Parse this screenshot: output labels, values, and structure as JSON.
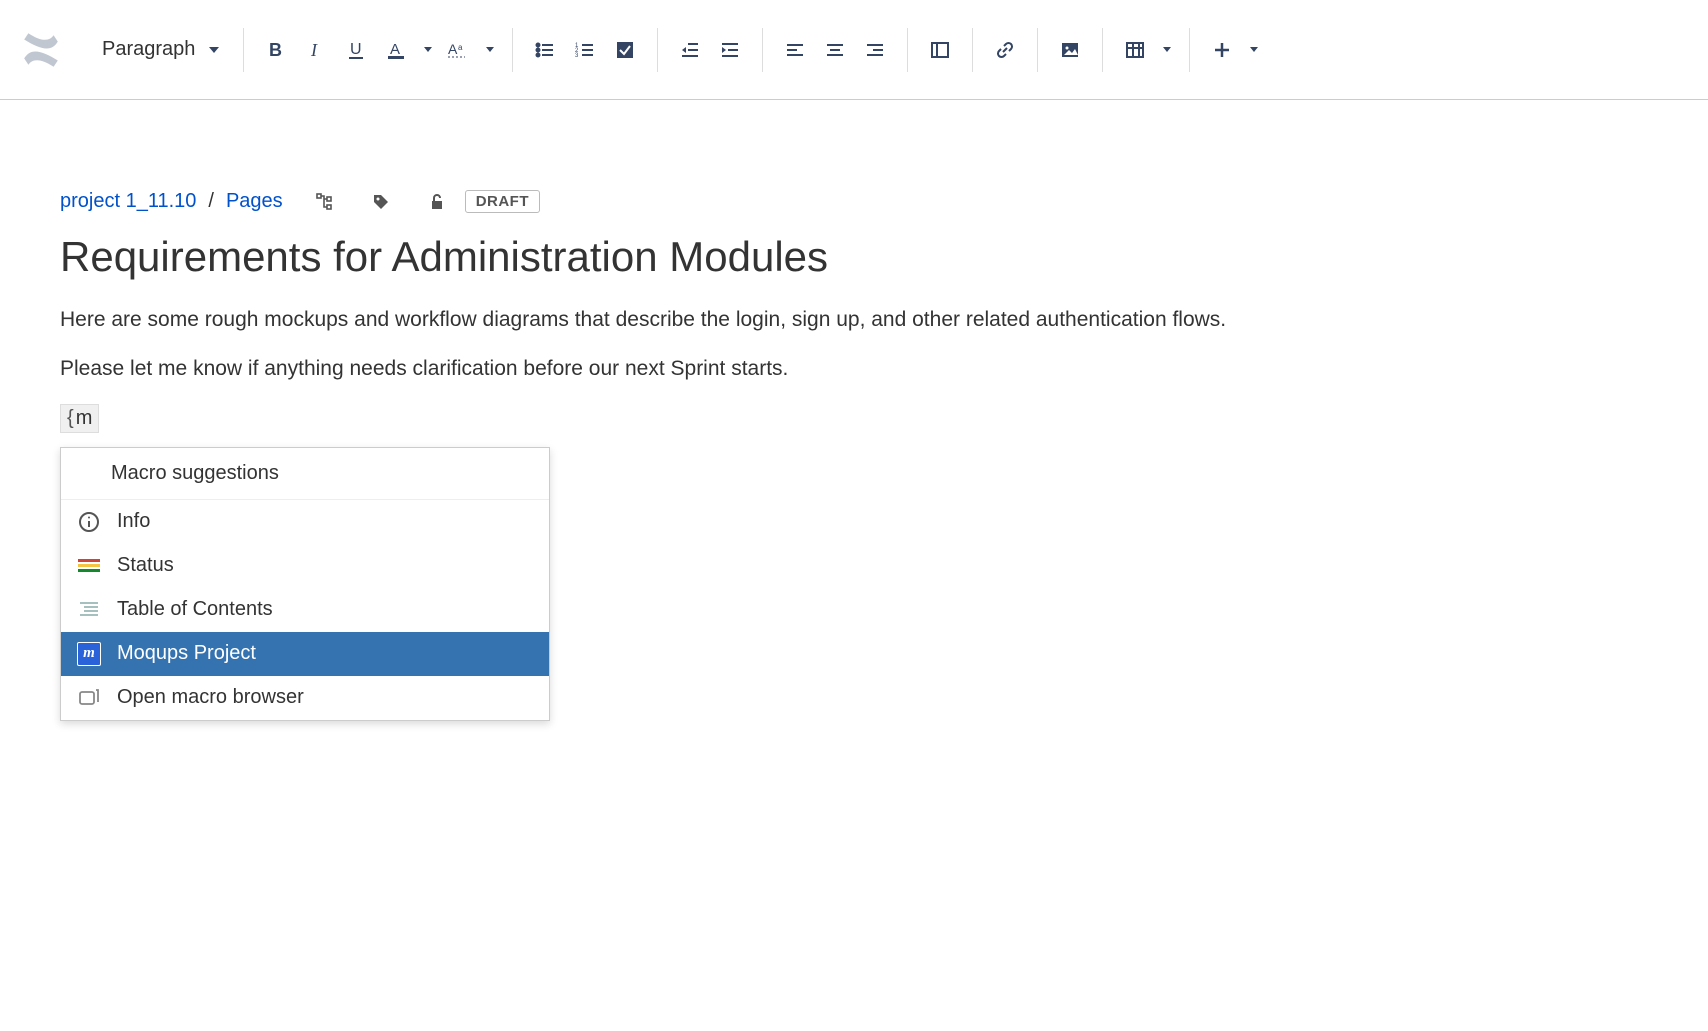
{
  "toolbar": {
    "paragraph_label": "Paragraph"
  },
  "breadcrumb": {
    "space": "project 1_11.10",
    "pages": "Pages",
    "draft_badge": "DRAFT"
  },
  "page": {
    "title": "Requirements for Administration Modules",
    "para1": "Here are some rough mockups and workflow diagrams that describe the login, sign up, and other related authentication flows.",
    "para2": "Please let me know if anything needs clarification before our next Sprint starts."
  },
  "macro": {
    "input_prefix": "{",
    "input_value": "m",
    "suggestions_header": "Macro suggestions",
    "items": [
      {
        "label": "Info",
        "icon": "info-icon",
        "selected": false
      },
      {
        "label": "Status",
        "icon": "status-icon",
        "selected": false
      },
      {
        "label": "Table of Contents",
        "icon": "toc-icon",
        "selected": false
      },
      {
        "label": "Moqups Project",
        "icon": "moqups-icon",
        "selected": true
      },
      {
        "label": "Open macro browser",
        "icon": "browser-icon",
        "selected": false
      }
    ]
  },
  "icons": {
    "moqups_glyph": "m"
  }
}
